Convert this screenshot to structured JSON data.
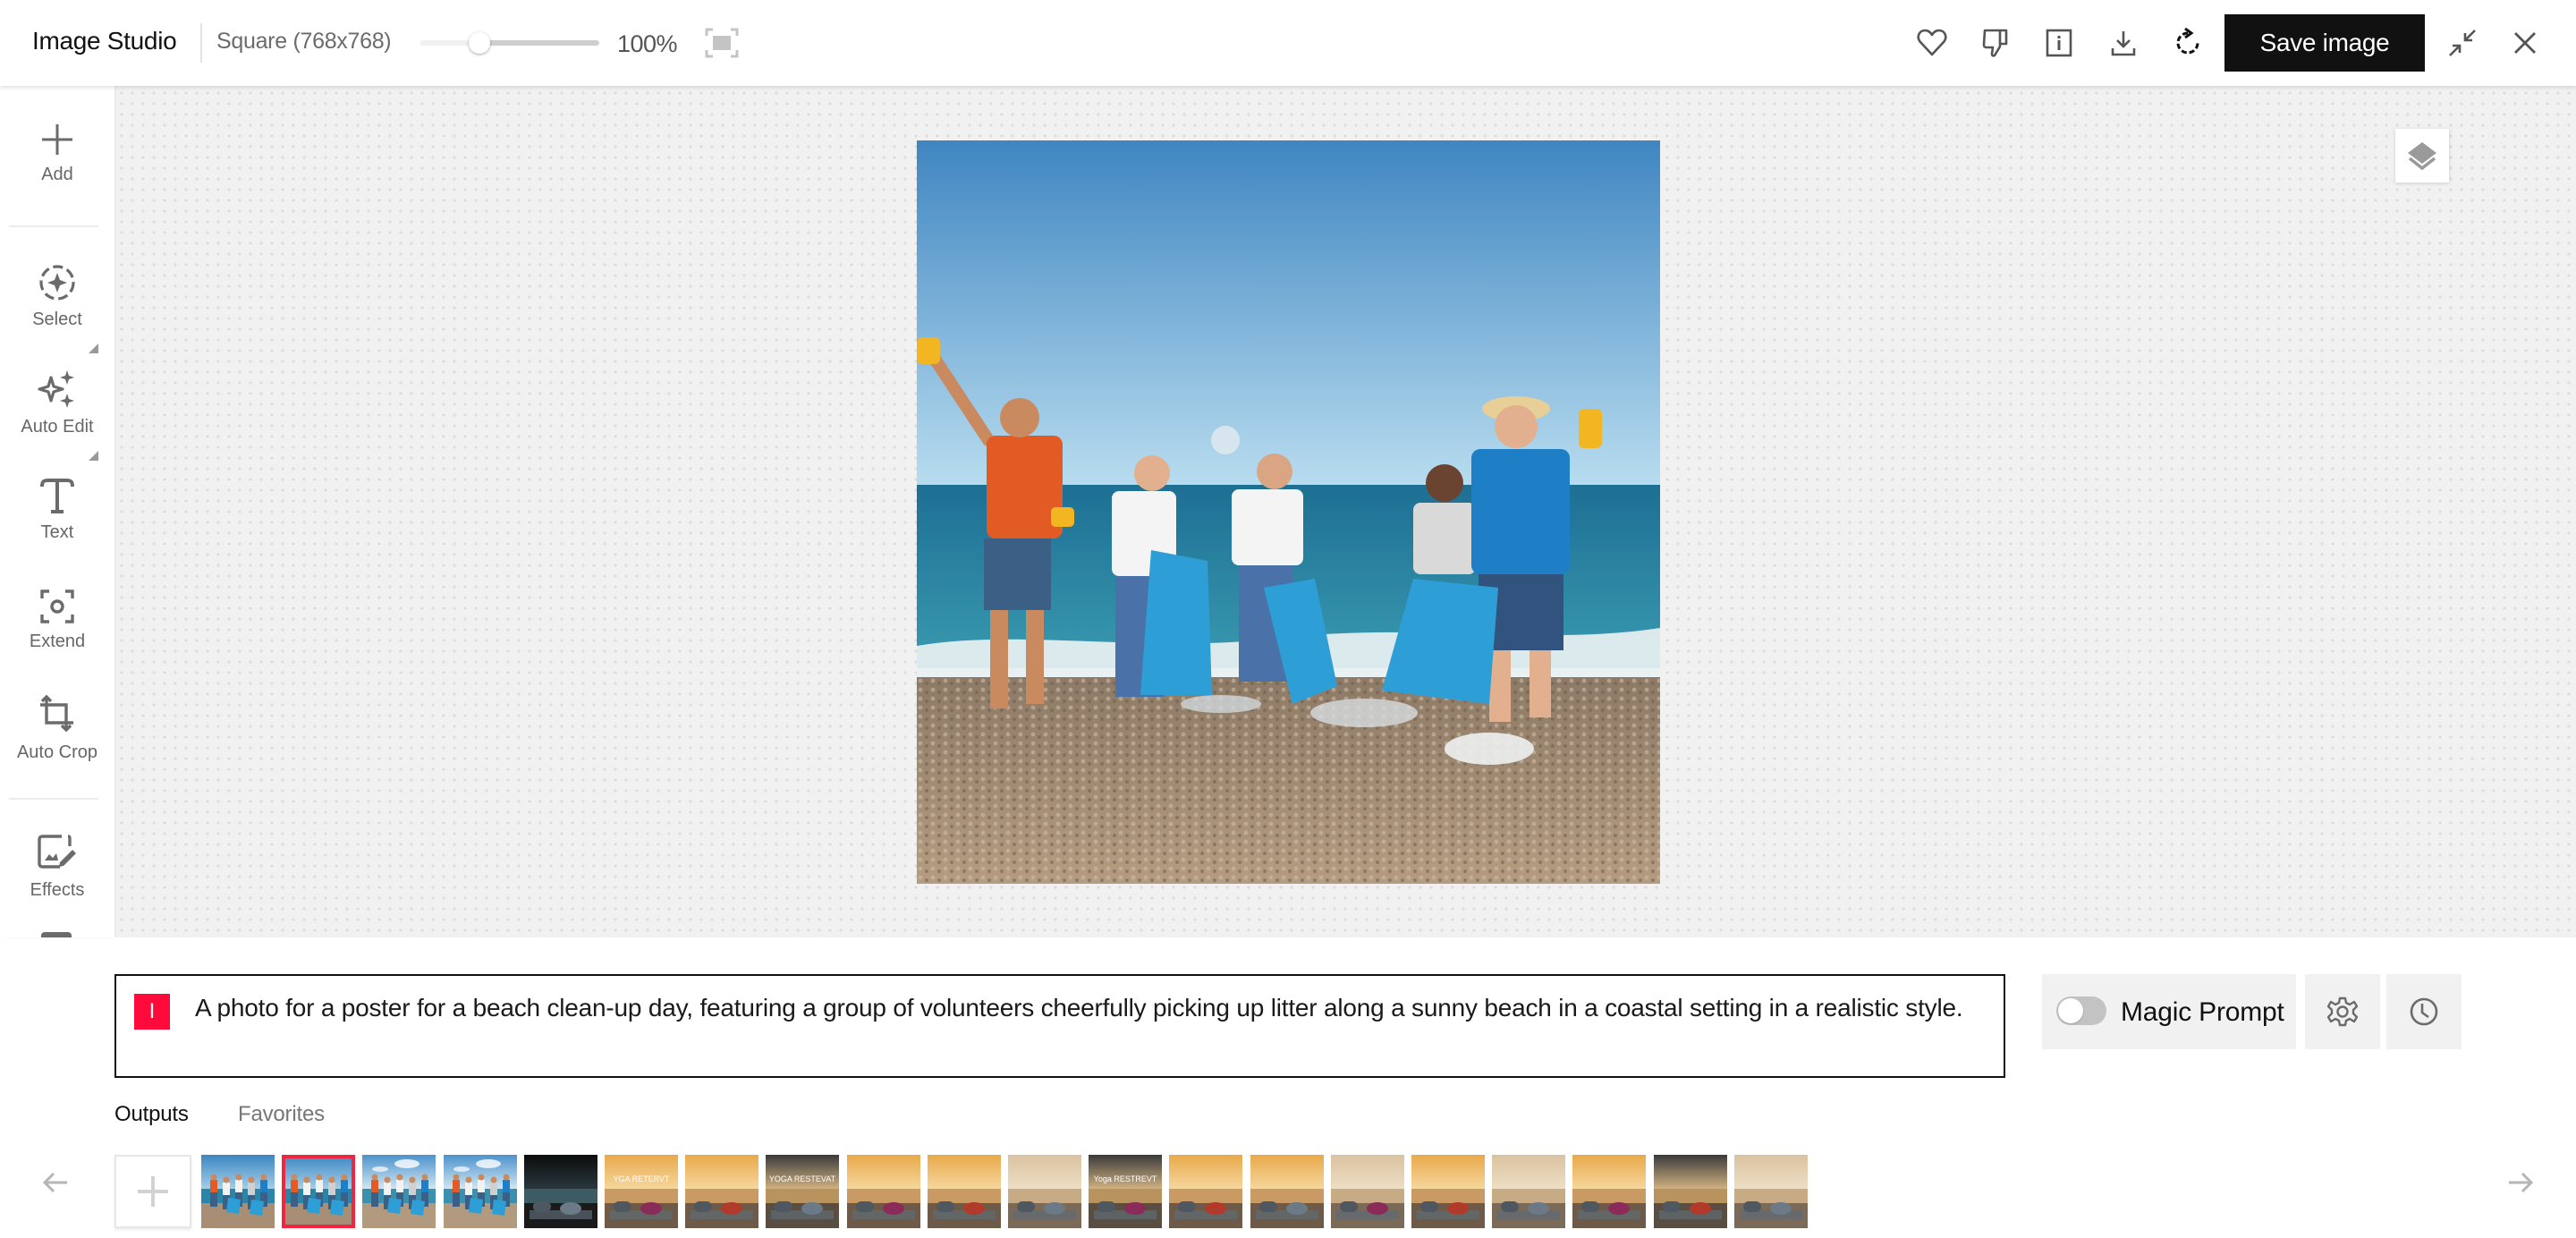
{
  "header": {
    "title": "Image Studio",
    "size_label": "Square (768x768)",
    "zoom_value": "100%",
    "zoom_slider_fraction": 0.33,
    "icons": [
      "heart-icon",
      "thumbs-down-icon",
      "info-icon",
      "download-icon",
      "regenerate-icon",
      "collapse-icon",
      "close-icon"
    ],
    "save_label": "Save image"
  },
  "sidebar": {
    "tools": [
      {
        "label": "Add",
        "icon": "plus-icon"
      },
      {
        "label": "Select",
        "icon": "select-icon",
        "has_submenu": true
      },
      {
        "label": "Auto Edit",
        "icon": "sparkle-icon",
        "has_submenu": true
      },
      {
        "label": "Text",
        "icon": "text-icon"
      },
      {
        "label": "Extend",
        "icon": "extend-icon"
      },
      {
        "label": "Auto Crop",
        "icon": "crop-icon"
      },
      {
        "label": "Effects",
        "icon": "effects-icon"
      }
    ]
  },
  "canvas": {
    "image_description": "Group of five volunteers with blue trash bags and yellow gloves cleaning a pebble beach under a clear blue sky",
    "layers_icon": "layers-icon"
  },
  "prompt": {
    "badge": "I",
    "text": "A photo for a poster for a beach clean-up day, featuring a group of volunteers cheerfully picking up litter along a sunny beach in a coastal setting in a realistic style."
  },
  "controls": {
    "magic_prompt_label": "Magic Prompt",
    "magic_prompt_enabled": false,
    "settings_icon": "gear-icon",
    "history_icon": "clock-icon"
  },
  "gallery": {
    "tabs": [
      {
        "label": "Outputs",
        "active": true
      },
      {
        "label": "Favorites",
        "active": false
      }
    ],
    "selected_index": 1,
    "thumbnails": [
      {
        "subject": "beach cleanup",
        "palette": "beach"
      },
      {
        "subject": "beach cleanup",
        "palette": "beach",
        "selected": true
      },
      {
        "subject": "beach cleanup",
        "palette": "beach-cloudy"
      },
      {
        "subject": "beach cleanup",
        "palette": "beach-cloudy"
      },
      {
        "subject": "yoga retreat poster",
        "palette": "dark",
        "text": ""
      },
      {
        "subject": "yoga retreat poster",
        "palette": "sunset",
        "text": "YGA RETERVT"
      },
      {
        "subject": "yoga retreat poster",
        "palette": "sunset"
      },
      {
        "subject": "yoga retreat poster",
        "palette": "dusk",
        "text": "YOGA RESTEVAT"
      },
      {
        "subject": "yoga mats lake",
        "palette": "sunset"
      },
      {
        "subject": "yoga mats lake",
        "palette": "sunset"
      },
      {
        "subject": "yoga mats lake",
        "palette": "lake"
      },
      {
        "subject": "yoga retreat poster",
        "palette": "dusk",
        "text": "Yoga RESTREVT"
      },
      {
        "subject": "yoga mats lake",
        "palette": "sunset"
      },
      {
        "subject": "yoga mats lake",
        "palette": "sunset"
      },
      {
        "subject": "yoga mats lake",
        "palette": "lake"
      },
      {
        "subject": "yoga mats lake",
        "palette": "sunset"
      },
      {
        "subject": "yoga retreat poster",
        "palette": "lake"
      },
      {
        "subject": "yoga mats lake",
        "palette": "sunset"
      },
      {
        "subject": "yoga mats lake",
        "palette": "dusk"
      },
      {
        "subject": "yoga mats lake",
        "palette": "lake"
      }
    ],
    "prev_icon": "arrow-left-icon",
    "next_icon": "arrow-right-icon",
    "add_icon": "plus-icon"
  }
}
